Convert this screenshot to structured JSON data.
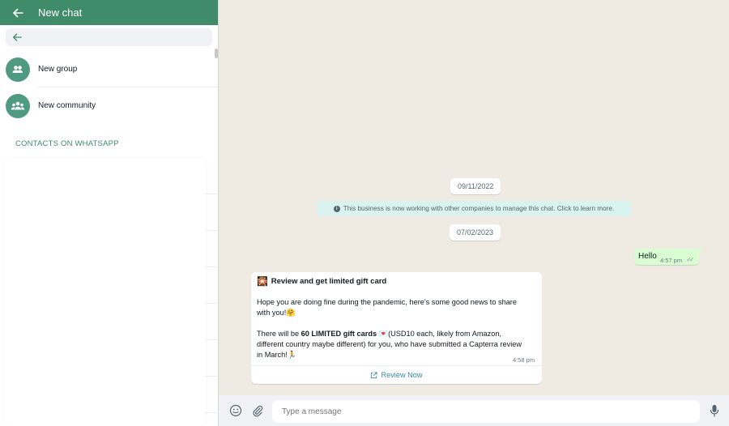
{
  "left_panel": {
    "header_title": "New chat",
    "search": {
      "value": "",
      "placeholder": ""
    },
    "items": [
      {
        "label": "New group",
        "icon": "group-icon"
      },
      {
        "label": "New community",
        "icon": "community-icon"
      }
    ],
    "section_title": "CONTACTS ON WHATSAPP"
  },
  "chat": {
    "dates": [
      "09/11/2022",
      "07/02/2023"
    ],
    "system_message": "This business is now working with other companies to manage this chat. Click to learn more.",
    "outgoing": {
      "text": "Hello",
      "time": "4:57 pm"
    },
    "incoming": {
      "title_emoji": "🎇",
      "title": "Review and get limited gift card",
      "para1": "Hope you are doing fine during the pandemic, here's some good news to share with you!🤗",
      "para2_prefix": "There will be ",
      "para2_bold": "60 LIMITED gift cards",
      "para2_rest": " 💌(USD10 each, likely from Amazon, different country maybe different) for you, who have submitted a Capterra review in March!🏃",
      "time": "4:58 pm",
      "action_label": "Review Now"
    },
    "composer": {
      "placeholder": "Type a message",
      "value": ""
    }
  },
  "colors": {
    "header_green": "#3f8b6a",
    "avatar_green": "#4f9a80",
    "outgoing_bubble": "#d9fdd3",
    "system_bubble": "#d9f4ee",
    "chat_background": "#efeae2",
    "link_blue": "#3a8aa8"
  }
}
